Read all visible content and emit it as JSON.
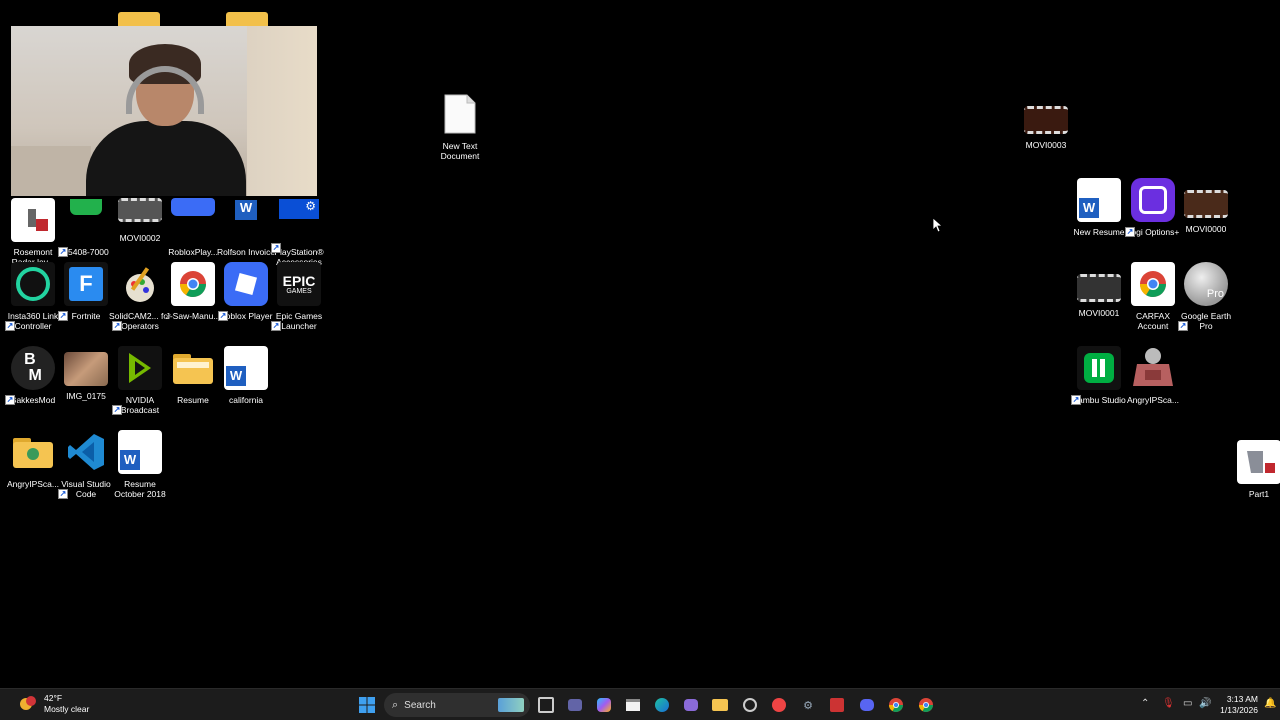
{
  "desktop_icons": [
    {
      "id": "rosemont",
      "label": "Rosemont Radar lev...",
      "icon": "excel-doc-icon",
      "shortcut": false
    },
    {
      "id": "05408",
      "label": "05408-7000",
      "icon": "green-app-icon",
      "shortcut": true
    },
    {
      "id": "movi0002",
      "label": "MOVI0002",
      "icon": "video-file-icon",
      "shortcut": false
    },
    {
      "id": "robloxplay",
      "label": "RobloxPlay...",
      "icon": "roblox-icon",
      "shortcut": true
    },
    {
      "id": "rolfson",
      "label": "Rolfson Invoice",
      "icon": "word-doc-icon",
      "shortcut": false
    },
    {
      "id": "ps-acc",
      "label": "PlayStation® Accessories",
      "icon": "playstation-gear-icon",
      "shortcut": true
    },
    {
      "id": "insta360",
      "label": "Insta360 Link Controller",
      "icon": "insta360-icon",
      "shortcut": true
    },
    {
      "id": "fortnite",
      "label": "Fortnite",
      "icon": "fortnite-icon",
      "shortcut": true
    },
    {
      "id": "solidcam",
      "label": "SolidCAM2... for Operators",
      "icon": "solidcam-icon",
      "shortcut": true
    },
    {
      "id": "jsaw",
      "label": "J-Saw-Manu...",
      "icon": "chrome-doc-icon",
      "shortcut": false
    },
    {
      "id": "roblox-player",
      "label": "Roblox Player",
      "icon": "roblox-icon",
      "shortcut": true
    },
    {
      "id": "epic",
      "label": "Epic Games Launcher",
      "icon": "epic-games-icon",
      "shortcut": true
    },
    {
      "id": "bakkesmod",
      "label": "BakkesMod",
      "icon": "bakkesmod-icon",
      "shortcut": true
    },
    {
      "id": "img0175",
      "label": "IMG_0175",
      "icon": "photo-icon",
      "shortcut": false
    },
    {
      "id": "nvidia",
      "label": "NVIDIA Broadcast",
      "icon": "nvidia-icon",
      "shortcut": true
    },
    {
      "id": "resume-folder",
      "label": "Resume",
      "icon": "folder-icon",
      "shortcut": false
    },
    {
      "id": "california",
      "label": "california",
      "icon": "word-doc-icon",
      "shortcut": false
    },
    {
      "id": "angryip1",
      "label": "AngryIPSca...",
      "icon": "folder-icon",
      "shortcut": false
    },
    {
      "id": "vscode",
      "label": "Visual Studio Code",
      "icon": "vscode-icon",
      "shortcut": true
    },
    {
      "id": "resume-2018",
      "label": "Resume October 2018",
      "icon": "word-doc-icon",
      "shortcut": false
    },
    {
      "id": "newtext",
      "label": "New Text Document",
      "icon": "text-file-icon",
      "shortcut": false
    },
    {
      "id": "movi0003",
      "label": "MOVI0003",
      "icon": "video-file-icon",
      "shortcut": false
    },
    {
      "id": "newresume",
      "label": "New Resume",
      "icon": "word-doc-icon",
      "shortcut": false
    },
    {
      "id": "logi",
      "label": "Logi Options+",
      "icon": "logi-icon",
      "shortcut": true
    },
    {
      "id": "movi0000",
      "label": "MOVI0000",
      "icon": "video-file-icon",
      "shortcut": false
    },
    {
      "id": "movi0001",
      "label": "MOVI0001",
      "icon": "video-file-icon",
      "shortcut": false
    },
    {
      "id": "carfax",
      "label": "CARFAX Account",
      "icon": "chrome-doc-icon",
      "shortcut": false
    },
    {
      "id": "gearth",
      "label": "Google Earth Pro",
      "icon": "google-earth-icon",
      "shortcut": true
    },
    {
      "id": "bambu",
      "label": "Bambu Studio",
      "icon": "bambu-icon",
      "shortcut": true
    },
    {
      "id": "angryip2",
      "label": "AngryIPSca...",
      "icon": "angryip-icon",
      "shortcut": false
    },
    {
      "id": "part1",
      "label": "Part1",
      "icon": "solid-part-icon",
      "shortcut": false
    }
  ],
  "taskbar": {
    "weather": {
      "temp": "42°F",
      "condition": "Mostly clear"
    },
    "search_placeholder": "Search",
    "clock": {
      "time": "3:13 AM",
      "date": "1/13/2026"
    },
    "pinned": [
      "windows-start-icon",
      "task-view-icon",
      "teams-icon",
      "copilot-icon",
      "store-icon",
      "edge-icon",
      "game-icon",
      "file-explorer-icon",
      "snipping-icon",
      "app-icon",
      "settings-icon",
      "solidworks-icon",
      "discord-icon",
      "chrome-icon",
      "chrome-alt-icon"
    ]
  }
}
